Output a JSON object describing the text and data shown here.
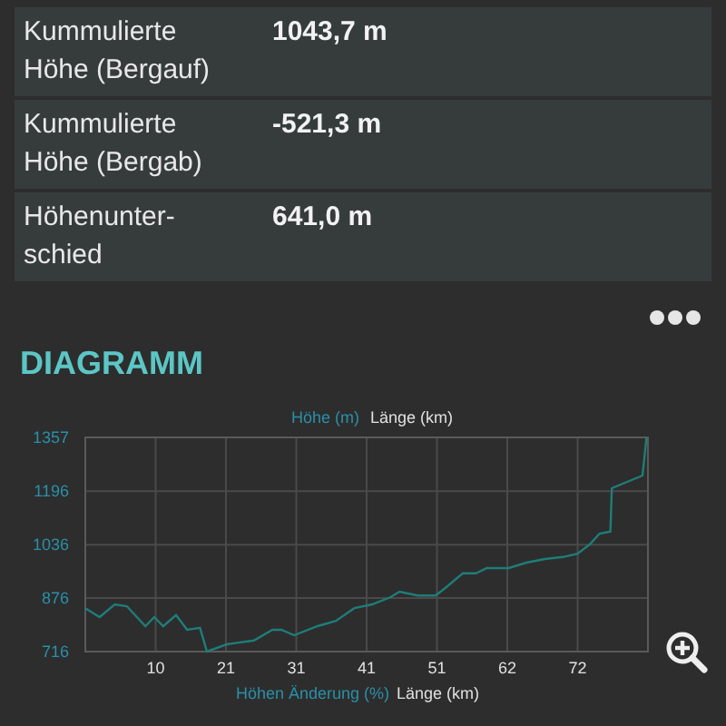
{
  "stats": [
    {
      "label": "Kummulierte Höhe (Bergauf)",
      "value": "1043,7 m"
    },
    {
      "label": "Kummulierte Höhe (Bergab)",
      "value": "-521,3 m"
    },
    {
      "label": "Höhenunter-schied",
      "value": "641,0 m"
    }
  ],
  "section_title": "DIAGRAMM",
  "elevation_chart": {
    "chart_data": {
      "type": "line",
      "xlabel": "Länge (km)",
      "grid": true,
      "xlim": [
        0,
        82.4
      ],
      "ylim": [
        716,
        1357
      ],
      "xticks": [
        {
          "value": 10.3,
          "label": "10"
        },
        {
          "value": 20.6,
          "label": "21"
        },
        {
          "value": 30.9,
          "label": "31"
        },
        {
          "value": 41.2,
          "label": "41"
        },
        {
          "value": 51.5,
          "label": "51"
        },
        {
          "value": 61.8,
          "label": "62"
        },
        {
          "value": 72.1,
          "label": "72"
        }
      ],
      "yticks": [
        716,
        876,
        1036,
        1196,
        1357
      ],
      "x": [
        0,
        2.1,
        4.3,
        6.1,
        8.8,
        10.1,
        11.4,
        13.3,
        14.9,
        16.8,
        17.8,
        20.7,
        24.7,
        27.4,
        28.7,
        30.6,
        34.0,
        36.7,
        39.4,
        42.0,
        44.7,
        46.0,
        48.7,
        51.3,
        52.7,
        55.3,
        57.2,
        58.8,
        62.0,
        64.6,
        67.3,
        69.9,
        72.1,
        73.9,
        75.3,
        76.9,
        77.1,
        81.6,
        82.2
      ],
      "series": [
        {
          "name": "Höhe (m)",
          "color": "#1f7d78",
          "values": [
            846,
            819,
            857,
            852,
            792,
            819,
            792,
            825,
            781,
            787,
            716,
            738,
            749,
            781,
            781,
            765,
            792,
            808,
            846,
            857,
            879,
            895,
            884,
            884,
            906,
            950,
            950,
            966,
            966,
            982,
            993,
            999,
            1009,
            1037,
            1069,
            1075,
            1205,
            1243,
            1357
          ]
        }
      ]
    }
  },
  "gradient_chart": {
    "ylabel": "Höhen Änderung (%)",
    "xlabel": "Länge (km)"
  }
}
